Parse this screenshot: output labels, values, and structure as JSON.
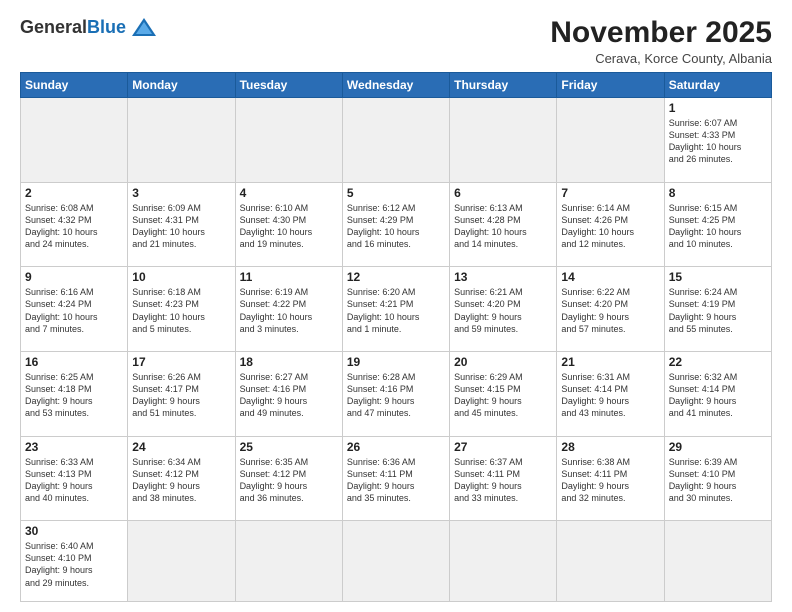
{
  "logo": {
    "general": "General",
    "blue": "Blue"
  },
  "title": "November 2025",
  "subtitle": "Cerava, Korce County, Albania",
  "days_header": [
    "Sunday",
    "Monday",
    "Tuesday",
    "Wednesday",
    "Thursday",
    "Friday",
    "Saturday"
  ],
  "weeks": [
    [
      {
        "day": "",
        "info": "",
        "empty": true
      },
      {
        "day": "",
        "info": "",
        "empty": true
      },
      {
        "day": "",
        "info": "",
        "empty": true
      },
      {
        "day": "",
        "info": "",
        "empty": true
      },
      {
        "day": "",
        "info": "",
        "empty": true
      },
      {
        "day": "",
        "info": "",
        "empty": true
      },
      {
        "day": "1",
        "info": "Sunrise: 6:07 AM\nSunset: 4:33 PM\nDaylight: 10 hours\nand 26 minutes."
      }
    ],
    [
      {
        "day": "2",
        "info": "Sunrise: 6:08 AM\nSunset: 4:32 PM\nDaylight: 10 hours\nand 24 minutes."
      },
      {
        "day": "3",
        "info": "Sunrise: 6:09 AM\nSunset: 4:31 PM\nDaylight: 10 hours\nand 21 minutes."
      },
      {
        "day": "4",
        "info": "Sunrise: 6:10 AM\nSunset: 4:30 PM\nDaylight: 10 hours\nand 19 minutes."
      },
      {
        "day": "5",
        "info": "Sunrise: 6:12 AM\nSunset: 4:29 PM\nDaylight: 10 hours\nand 16 minutes."
      },
      {
        "day": "6",
        "info": "Sunrise: 6:13 AM\nSunset: 4:28 PM\nDaylight: 10 hours\nand 14 minutes."
      },
      {
        "day": "7",
        "info": "Sunrise: 6:14 AM\nSunset: 4:26 PM\nDaylight: 10 hours\nand 12 minutes."
      },
      {
        "day": "8",
        "info": "Sunrise: 6:15 AM\nSunset: 4:25 PM\nDaylight: 10 hours\nand 10 minutes."
      }
    ],
    [
      {
        "day": "9",
        "info": "Sunrise: 6:16 AM\nSunset: 4:24 PM\nDaylight: 10 hours\nand 7 minutes."
      },
      {
        "day": "10",
        "info": "Sunrise: 6:18 AM\nSunset: 4:23 PM\nDaylight: 10 hours\nand 5 minutes."
      },
      {
        "day": "11",
        "info": "Sunrise: 6:19 AM\nSunset: 4:22 PM\nDaylight: 10 hours\nand 3 minutes."
      },
      {
        "day": "12",
        "info": "Sunrise: 6:20 AM\nSunset: 4:21 PM\nDaylight: 10 hours\nand 1 minute."
      },
      {
        "day": "13",
        "info": "Sunrise: 6:21 AM\nSunset: 4:20 PM\nDaylight: 9 hours\nand 59 minutes."
      },
      {
        "day": "14",
        "info": "Sunrise: 6:22 AM\nSunset: 4:20 PM\nDaylight: 9 hours\nand 57 minutes."
      },
      {
        "day": "15",
        "info": "Sunrise: 6:24 AM\nSunset: 4:19 PM\nDaylight: 9 hours\nand 55 minutes."
      }
    ],
    [
      {
        "day": "16",
        "info": "Sunrise: 6:25 AM\nSunset: 4:18 PM\nDaylight: 9 hours\nand 53 minutes."
      },
      {
        "day": "17",
        "info": "Sunrise: 6:26 AM\nSunset: 4:17 PM\nDaylight: 9 hours\nand 51 minutes."
      },
      {
        "day": "18",
        "info": "Sunrise: 6:27 AM\nSunset: 4:16 PM\nDaylight: 9 hours\nand 49 minutes."
      },
      {
        "day": "19",
        "info": "Sunrise: 6:28 AM\nSunset: 4:16 PM\nDaylight: 9 hours\nand 47 minutes."
      },
      {
        "day": "20",
        "info": "Sunrise: 6:29 AM\nSunset: 4:15 PM\nDaylight: 9 hours\nand 45 minutes."
      },
      {
        "day": "21",
        "info": "Sunrise: 6:31 AM\nSunset: 4:14 PM\nDaylight: 9 hours\nand 43 minutes."
      },
      {
        "day": "22",
        "info": "Sunrise: 6:32 AM\nSunset: 4:14 PM\nDaylight: 9 hours\nand 41 minutes."
      }
    ],
    [
      {
        "day": "23",
        "info": "Sunrise: 6:33 AM\nSunset: 4:13 PM\nDaylight: 9 hours\nand 40 minutes."
      },
      {
        "day": "24",
        "info": "Sunrise: 6:34 AM\nSunset: 4:12 PM\nDaylight: 9 hours\nand 38 minutes."
      },
      {
        "day": "25",
        "info": "Sunrise: 6:35 AM\nSunset: 4:12 PM\nDaylight: 9 hours\nand 36 minutes."
      },
      {
        "day": "26",
        "info": "Sunrise: 6:36 AM\nSunset: 4:11 PM\nDaylight: 9 hours\nand 35 minutes."
      },
      {
        "day": "27",
        "info": "Sunrise: 6:37 AM\nSunset: 4:11 PM\nDaylight: 9 hours\nand 33 minutes."
      },
      {
        "day": "28",
        "info": "Sunrise: 6:38 AM\nSunset: 4:11 PM\nDaylight: 9 hours\nand 32 minutes."
      },
      {
        "day": "29",
        "info": "Sunrise: 6:39 AM\nSunset: 4:10 PM\nDaylight: 9 hours\nand 30 minutes."
      }
    ],
    [
      {
        "day": "30",
        "info": "Sunrise: 6:40 AM\nSunset: 4:10 PM\nDaylight: 9 hours\nand 29 minutes.",
        "last": true
      },
      {
        "day": "",
        "info": "",
        "empty": true,
        "last": true
      },
      {
        "day": "",
        "info": "",
        "empty": true,
        "last": true
      },
      {
        "day": "",
        "info": "",
        "empty": true,
        "last": true
      },
      {
        "day": "",
        "info": "",
        "empty": true,
        "last": true
      },
      {
        "day": "",
        "info": "",
        "empty": true,
        "last": true
      },
      {
        "day": "",
        "info": "",
        "empty": true,
        "last": true
      }
    ]
  ]
}
